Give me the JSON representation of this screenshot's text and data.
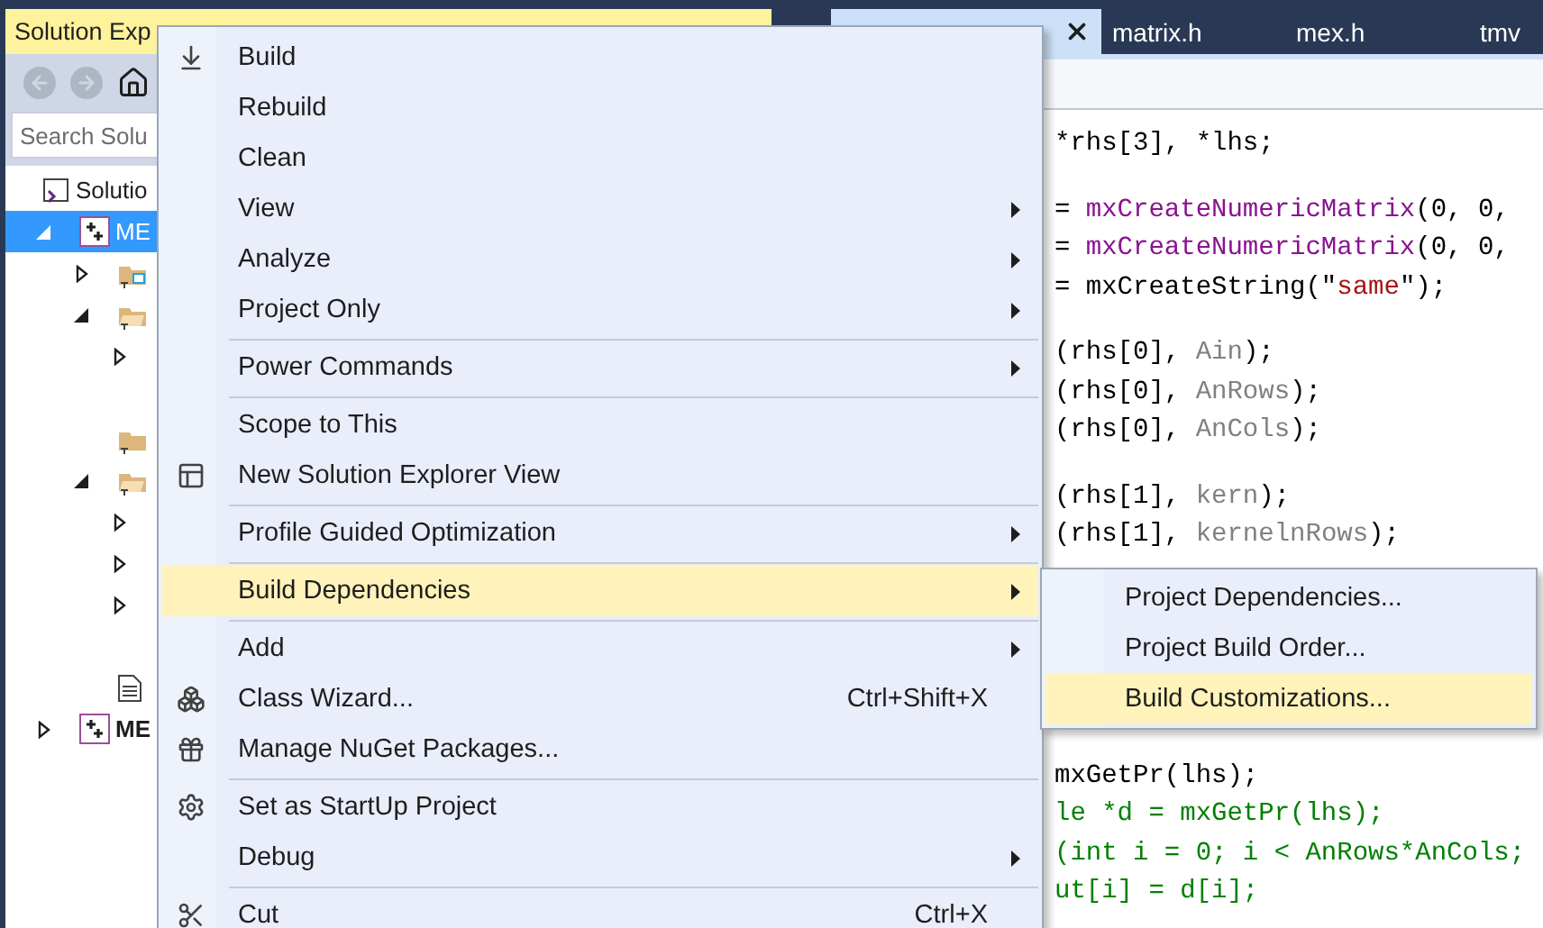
{
  "explorer": {
    "title": "Solution Exp",
    "search": {
      "placeholder": "Search Solu"
    },
    "tree": [
      {
        "label": "Solutio",
        "kind": "solution",
        "selected": false,
        "children": [
          {
            "label": "ME",
            "kind": "project",
            "selected": true,
            "expanded": true,
            "children": [
              {
                "kind": "reference",
                "selected": false,
                "expanded": false
              },
              {
                "kind": "filter",
                "selected": false,
                "expanded": true,
                "children": [
                  {
                    "selected": false,
                    "expanded": false
                  },
                  {
                    "selected": false
                  }
                ]
              },
              {
                "kind": "folder",
                "selected": false
              },
              {
                "kind": "filter",
                "selected": false,
                "expanded": true,
                "children": [
                  {
                    "selected": false,
                    "expanded": false
                  },
                  {
                    "selected": false,
                    "expanded": false
                  },
                  {
                    "selected": false,
                    "expanded": false
                  },
                  {
                    "selected": false
                  }
                ]
              },
              {
                "kind": "file",
                "selected": false
              }
            ]
          },
          {
            "label": "ME",
            "kind": "project",
            "bold": true,
            "selected": false,
            "expanded": false
          }
        ]
      }
    ]
  },
  "editor": {
    "tabs": [
      {
        "selected": true,
        "closable": true
      },
      {
        "label": "matrix.h",
        "selected": false
      },
      {
        "label": "mex.h",
        "selected": false
      },
      {
        "label": "tmv",
        "selected": false
      }
    ],
    "code_blocks": [
      [
        [
          {
            "text": "*rhs[3], *lhs;",
            "kind": "plain"
          }
        ]
      ],
      [
        [
          {
            "text": "= ",
            "kind": "plain"
          },
          {
            "text": "mxCreateNumericMatrix",
            "kind": "function"
          },
          {
            "text": "(0, 0, ",
            "kind": "plain"
          }
        ],
        [
          {
            "text": "= ",
            "kind": "plain"
          },
          {
            "text": "mxCreateNumericMatrix",
            "kind": "function"
          },
          {
            "text": "(0, 0, ",
            "kind": "plain"
          }
        ],
        [
          {
            "text": "= mxCreateString(\"",
            "kind": "plain"
          },
          {
            "text": "same",
            "kind": "string"
          },
          {
            "text": "\");",
            "kind": "plain"
          }
        ]
      ],
      [
        [
          {
            "text": "(rhs[0], ",
            "kind": "plain"
          },
          {
            "text": "Ain",
            "kind": "parameter"
          },
          {
            "text": ");",
            "kind": "plain"
          }
        ],
        [
          {
            "text": "(rhs[0], ",
            "kind": "plain"
          },
          {
            "text": "AnRows",
            "kind": "parameter"
          },
          {
            "text": ");",
            "kind": "plain"
          }
        ],
        [
          {
            "text": "(rhs[0], ",
            "kind": "plain"
          },
          {
            "text": "AnCols",
            "kind": "parameter"
          },
          {
            "text": ");",
            "kind": "plain"
          }
        ]
      ],
      [
        [
          {
            "text": "(rhs[1], ",
            "kind": "plain"
          },
          {
            "text": "kern",
            "kind": "parameter"
          },
          {
            "text": ");",
            "kind": "plain"
          }
        ],
        [
          {
            "text": "(rhs[1], ",
            "kind": "plain"
          },
          {
            "text": "kernelnRows",
            "kind": "parameter"
          },
          {
            "text": ");",
            "kind": "plain"
          }
        ]
      ],
      [
        [
          {
            "text": "mxGetPr(lhs);",
            "kind": "plain"
          }
        ],
        [
          {
            "text": "le *d = mxGetPr(lhs);",
            "kind": "comment"
          }
        ],
        [
          {
            "text": "(int i = 0; i < AnRows*AnCols;",
            "kind": "comment"
          }
        ],
        [
          {
            "text": "ut[i] = d[i];",
            "kind": "comment"
          }
        ]
      ]
    ]
  },
  "context_menu": {
    "items": [
      {
        "kind": "item",
        "label": "Build",
        "selected": false,
        "submenu": false
      },
      {
        "kind": "item",
        "label": "Rebuild",
        "selected": false,
        "submenu": false
      },
      {
        "kind": "item",
        "label": "Clean",
        "selected": false,
        "submenu": false
      },
      {
        "kind": "item",
        "label": "View",
        "selected": false,
        "submenu": true
      },
      {
        "kind": "item",
        "label": "Analyze",
        "selected": false,
        "submenu": true
      },
      {
        "kind": "item",
        "label": "Project Only",
        "selected": false,
        "submenu": true
      },
      {
        "kind": "separator"
      },
      {
        "kind": "item",
        "label": "Power Commands",
        "selected": false,
        "submenu": true
      },
      {
        "kind": "separator"
      },
      {
        "kind": "item",
        "label": "Scope to This",
        "selected": false,
        "submenu": false
      },
      {
        "kind": "item",
        "label": "New Solution Explorer View",
        "selected": false,
        "submenu": false
      },
      {
        "kind": "separator"
      },
      {
        "kind": "item",
        "label": "Profile Guided Optimization",
        "selected": false,
        "submenu": true
      },
      {
        "kind": "separator"
      },
      {
        "kind": "item",
        "label": "Build Dependencies",
        "selected": true,
        "submenu": true
      },
      {
        "kind": "separator"
      },
      {
        "kind": "item",
        "label": "Add",
        "selected": false,
        "submenu": true
      },
      {
        "kind": "item",
        "label": "Class Wizard...",
        "shortcut": "Ctrl+Shift+X",
        "selected": false,
        "submenu": false
      },
      {
        "kind": "item",
        "label": "Manage NuGet Packages...",
        "selected": false,
        "submenu": false
      },
      {
        "kind": "separator"
      },
      {
        "kind": "item",
        "label": "Set as StartUp Project",
        "selected": false,
        "submenu": false
      },
      {
        "kind": "item",
        "label": "Debug",
        "selected": false,
        "submenu": true
      },
      {
        "kind": "separator"
      },
      {
        "kind": "item",
        "label": "Cut",
        "shortcut": "Ctrl+X",
        "selected": false,
        "submenu": false
      }
    ]
  },
  "submenu": {
    "items": [
      {
        "label": "Project Dependencies...",
        "selected": false
      },
      {
        "label": "Project Build Order...",
        "selected": false
      },
      {
        "label": "Build Customizations...",
        "selected": true
      }
    ]
  }
}
